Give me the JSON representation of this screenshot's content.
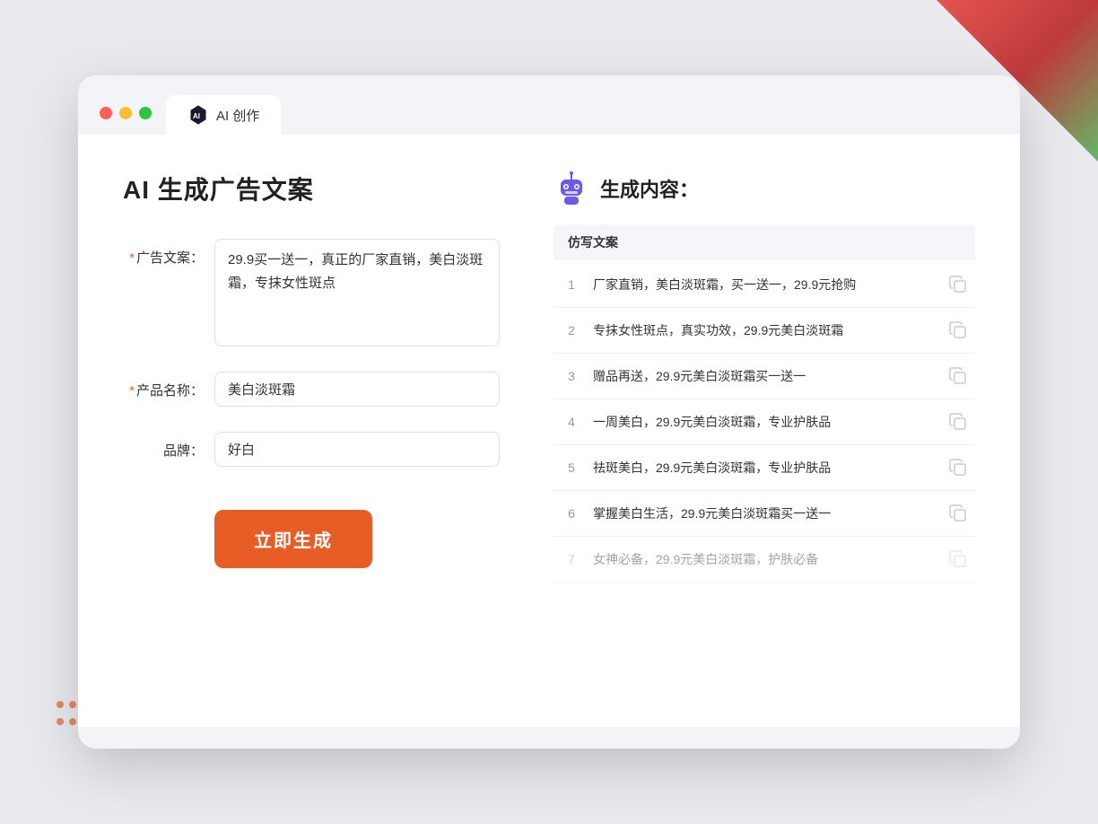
{
  "browser": {
    "tab_title": "AI 创作",
    "traffic_lights": [
      "red",
      "yellow",
      "green"
    ]
  },
  "left_panel": {
    "page_title": "AI 生成广告文案",
    "form": {
      "ad_copy_label": "广告文案：",
      "ad_copy_required": "*",
      "ad_copy_value": "29.9买一送一，真正的厂家直销，美白淡斑霜，专抹女性斑点",
      "product_name_label": "产品名称：",
      "product_name_required": "*",
      "product_name_value": "美白淡斑霜",
      "brand_label": "品牌：",
      "brand_value": "好白"
    },
    "submit_button": "立即生成"
  },
  "right_panel": {
    "results_title": "生成内容：",
    "table_header": "仿写文案",
    "results": [
      {
        "num": 1,
        "text": "厂家直销，美白淡斑霜，买一送一，29.9元抢购",
        "faded": false
      },
      {
        "num": 2,
        "text": "专抹女性斑点，真实功效，29.9元美白淡斑霜",
        "faded": false
      },
      {
        "num": 3,
        "text": "赠品再送，29.9元美白淡斑霜买一送一",
        "faded": false
      },
      {
        "num": 4,
        "text": "一周美白，29.9元美白淡斑霜，专业护肤品",
        "faded": false
      },
      {
        "num": 5,
        "text": "祛斑美白，29.9元美白淡斑霜，专业护肤品",
        "faded": false
      },
      {
        "num": 6,
        "text": "掌握美白生活，29.9元美白淡斑霜买一送一",
        "faded": false
      },
      {
        "num": 7,
        "text": "女神必备，29.9元美白淡斑霜，护肤必备",
        "faded": true
      }
    ]
  }
}
